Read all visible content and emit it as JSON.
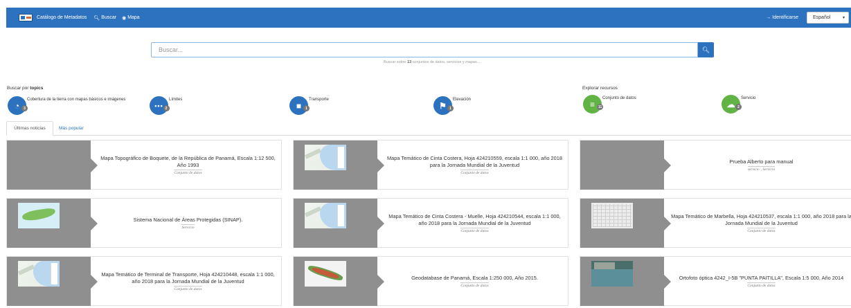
{
  "navbar": {
    "brand_label": "Catálogo de Metadatos",
    "search_label": "Buscar",
    "map_label": "Mapa",
    "login_label": "Identificarse",
    "language_selected": "Español"
  },
  "search": {
    "placeholder": "Buscar...",
    "hint_prefix": "Buscar sobre",
    "hint_count": "13",
    "hint_suffix": "conjuntos de datos, servicios y mapas....",
    "button_icon": "search-icon"
  },
  "topics": {
    "heading_prefix": "Buscar por",
    "heading_bold": "topics",
    "items": [
      {
        "label": "Cobertura de la tierra con mapas básicos e imágenes",
        "count": "3",
        "icon": "globe-icon"
      },
      {
        "label": "Límites",
        "count": "2",
        "icon": "dots-icon"
      },
      {
        "label": "Transporte",
        "count": "1",
        "icon": "truck-icon"
      },
      {
        "label": "Elevación",
        "count": "1",
        "icon": "flag-icon"
      }
    ]
  },
  "resources": {
    "heading": "Explorar recursos",
    "items": [
      {
        "label": "Conjunto de datos",
        "count": "11",
        "icon": "database-icon"
      },
      {
        "label": "Servicio",
        "count": "2",
        "icon": "cloud-icon"
      }
    ]
  },
  "tabs": {
    "latest": "Últimas noticias",
    "popular": "Más popular"
  },
  "cards": [
    {
      "title": "Mapa Topográfico de Boquete, de la República de Panamá, Escala 1:12 500, Año 1993",
      "type": "Conjunto de datos"
    },
    {
      "title": "Mapa Temático de Cinta Costera, Hoja 424210559, escala 1:1 000, año 2018 para la Jornada Mundial de la Juventud",
      "type": "Conjunto de datos"
    },
    {
      "title": "Prueba Alberto para manual",
      "type": "service- , Servicio"
    },
    {
      "title": "Sistema Nacional de Áreas Protegidas (SINAP).",
      "type": "Servicio"
    },
    {
      "title": "Mapa Temático de Cinta Costera - Muelle, Hoja 424210544, escala 1:1 000, año 2018 para la Jornada Mundial de la Juventud",
      "type": "Conjunto de datos"
    },
    {
      "title": "Mapa Temático de Marbella, Hoja 424210537, escala 1:1 000, año 2018 para la Jornada Mundial de la Juventud",
      "type": "Conjunto de datos"
    },
    {
      "title": "Mapa Temático de Terminal de Transporte, Hoja 424210448, escala 1:1 000, año 2018 para la Jornada Mundial de la Juventud",
      "type": "Conjunto de datos"
    },
    {
      "title": "Geodatabase de Panamá, Escala 1:250 000, Año 2015.",
      "type": "Conjunto de datos"
    },
    {
      "title": "Ortofoto óptica 4242_I-5B \"PUNTA PAITILLA\", Escala 1:5 000, Año 2014",
      "type": "Conjunto de datos"
    }
  ]
}
